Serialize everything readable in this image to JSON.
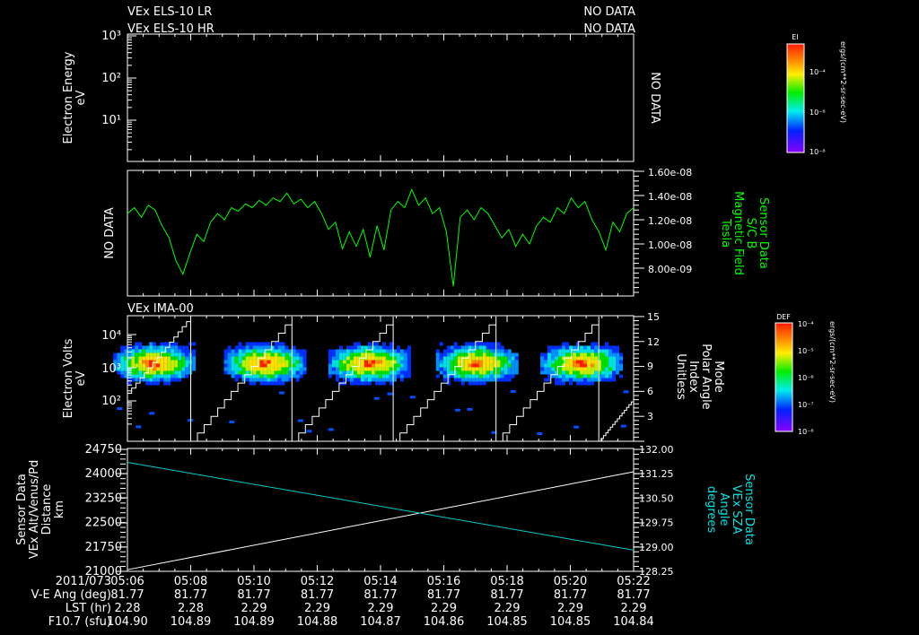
{
  "header": {
    "lr_title": "VEx ELS-10 LR",
    "lr_status": "NO DATA",
    "hr_title": "VEx ELS-10 HR",
    "hr_status": "NO DATA"
  },
  "colorbars": {
    "ei": {
      "title": "EI",
      "labels": [
        "10⁻⁴",
        "10⁻⁶",
        "10⁻⁸"
      ],
      "units": "ergs/(cm**2-sr-sec-eV)"
    },
    "def": {
      "title": "DEF",
      "labels": [
        "10⁻⁴",
        "10⁻⁵",
        "10⁻⁶",
        "10⁻⁷",
        "10⁻⁸"
      ],
      "units": "ergs/(cm**2-sr-sec-eV)"
    }
  },
  "footer": {
    "row_labels": [
      "2011/073",
      "V-E Ang (deg)",
      "LST (hr)",
      "F10.7 (sfu)"
    ],
    "times": [
      "05:06",
      "05:08",
      "05:10",
      "05:12",
      "05:14",
      "05:16",
      "05:18",
      "05:20",
      "05:22"
    ],
    "ve_ang": [
      "81.77",
      "81.77",
      "81.77",
      "81.77",
      "81.77",
      "81.77",
      "81.77",
      "81.77",
      "81.77"
    ],
    "lst": [
      "2.28",
      "2.28",
      "2.29",
      "2.29",
      "2.29",
      "2.29",
      "2.29",
      "2.29",
      "2.29"
    ],
    "f107": [
      "104.90",
      "104.89",
      "104.89",
      "104.88",
      "104.87",
      "104.86",
      "104.85",
      "104.85",
      "104.84"
    ]
  },
  "chart_data": [
    {
      "type": "heatmap",
      "title": "VEx ELS-10 LR / HR",
      "ylabel": [
        "Electron Energy",
        "eV"
      ],
      "yscale": "log",
      "yticks": [
        "10³",
        "10²",
        "10¹"
      ],
      "status": "NO DATA"
    },
    {
      "type": "line",
      "left_status": "NO DATA",
      "ylabel_right": [
        "Sensor Data",
        "S/C  B",
        "Magnetic Field",
        "Tesla"
      ],
      "yticks": [
        "1.60e-08",
        "1.40e-08",
        "1.20e-08",
        "1.00e-08",
        "8.00e-09"
      ],
      "ylim": [
        5.7e-09,
        1.6e-08
      ],
      "color": "#00ff00",
      "xlim_min": [
        0,
        16
      ],
      "values": [
        1.25e-08,
        1.3e-08,
        1.22e-08,
        1.32e-08,
        1.28e-08,
        1.15e-08,
        1.05e-08,
        8.6e-09,
        7.5e-09,
        9.2e-09,
        1.08e-08,
        1.02e-08,
        1.18e-08,
        1.25e-08,
        1.2e-08,
        1.3e-08,
        1.27e-08,
        1.33e-08,
        1.3e-08,
        1.36e-08,
        1.32e-08,
        1.38e-08,
        1.35e-08,
        1.42e-08,
        1.33e-08,
        1.37e-08,
        1.3e-08,
        1.35e-08,
        1.25e-08,
        1.12e-08,
        1.18e-08,
        9.6e-09,
        1.1e-08,
        9.8e-09,
        1.12e-08,
        8.9e-09,
        1.15e-08,
        9.5e-09,
        1.28e-08,
        1.35e-08,
        1.3e-08,
        1.45e-08,
        1.32e-08,
        1.38e-08,
        1.25e-08,
        1.3e-08,
        1.1e-08,
        6.5e-09,
        1.22e-08,
        1.28e-08,
        1.2e-08,
        1.3e-08,
        1.25e-08,
        1.15e-08,
        1.05e-08,
        1.12e-08,
        9.8e-09,
        1.08e-08,
        1e-08,
        1.15e-08,
        1.22e-08,
        1.18e-08,
        1.3e-08,
        1.25e-08,
        1.38e-08,
        1.3e-08,
        1.35e-08,
        1.2e-08,
        1.1e-08,
        9.5e-09,
        1.18e-08,
        1.1e-08,
        1.25e-08,
        1.3e-08
      ]
    },
    {
      "type": "heatmap",
      "title": "VEx IMA-00",
      "ylabel": [
        "Electron Volts",
        "eV"
      ],
      "yscale": "log",
      "yticks": [
        "10⁴",
        "10³",
        "10²"
      ],
      "ylabel_right": [
        "Mode",
        "Polar Angle",
        "Index",
        "Unitless"
      ],
      "yticks_right": [
        "15",
        "12",
        "9",
        "6",
        "3"
      ],
      "ylim_right": [
        0,
        15
      ],
      "blob_centers_min": [
        0.8,
        4.3,
        7.6,
        11.0,
        14.3
      ],
      "blob_energy_eV": 1500,
      "angle_reset_min": [
        2.0,
        5.2,
        8.4,
        11.65,
        14.9
      ]
    },
    {
      "type": "line",
      "ylabel": [
        "Sensor Data",
        "VEx Alt/Venus/Pd",
        "Distance",
        "km"
      ],
      "yticks": [
        "24750",
        "24000",
        "23250",
        "22500",
        "21750",
        "21000"
      ],
      "ylim": [
        21000,
        24750
      ],
      "ylabel_right": [
        "Sensor Data",
        "VEx SZA",
        "Angle",
        "degrees"
      ],
      "yticks_right": [
        "132.00",
        "131.25",
        "130.50",
        "129.75",
        "129.00",
        "128.25"
      ],
      "ylim_right": [
        128.25,
        132.0
      ],
      "series": [
        {
          "name": "Distance",
          "color": "#ffffff",
          "x_min": [
            0,
            16
          ],
          "values": [
            21050,
            24060
          ]
        },
        {
          "name": "SZA",
          "color": "#00cccc",
          "x_min": [
            0,
            16
          ],
          "values": [
            131.6,
            128.9
          ]
        }
      ]
    }
  ]
}
